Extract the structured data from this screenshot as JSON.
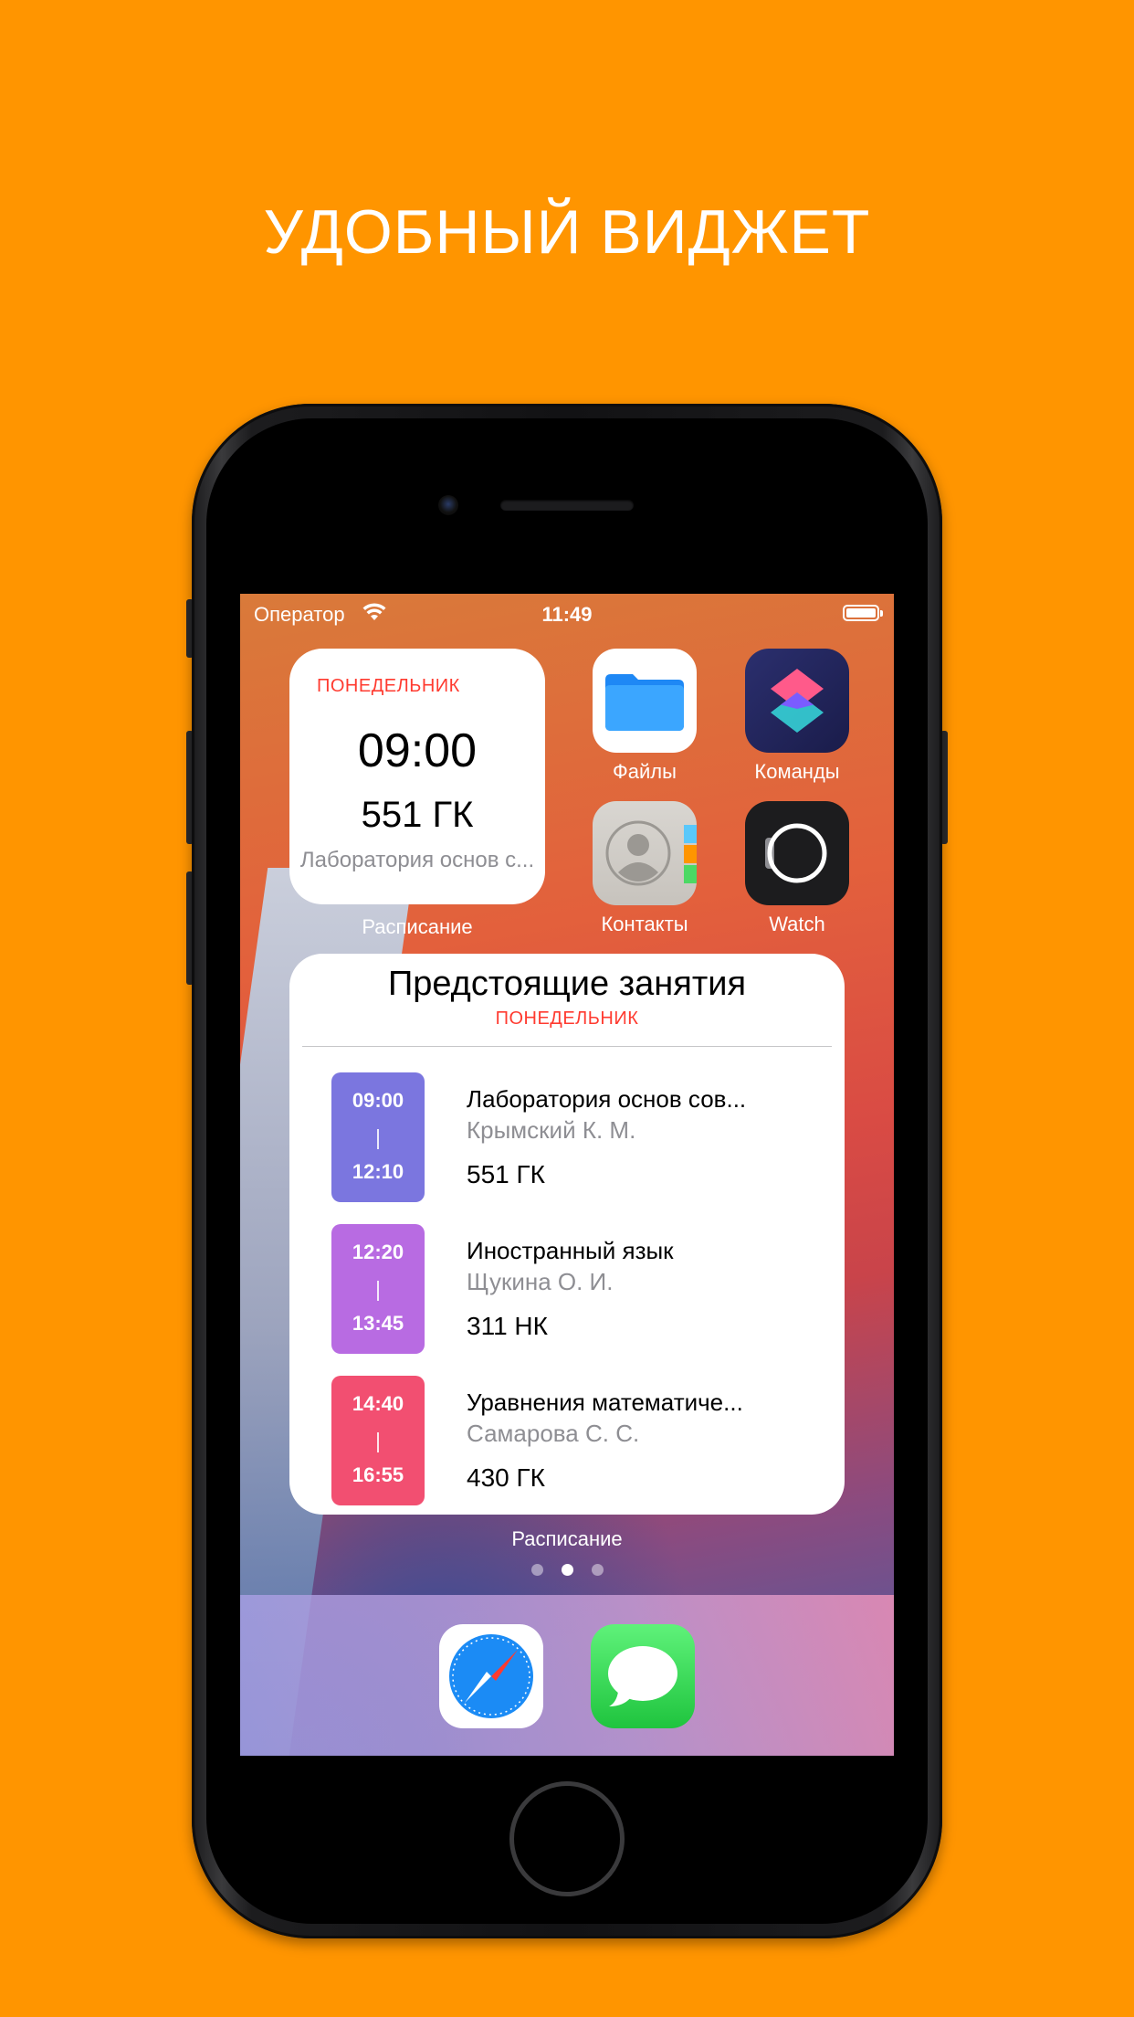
{
  "headline": "УДОБНЫЙ ВИДЖЕТ",
  "status_bar": {
    "carrier": "Оператор",
    "time": "11:49"
  },
  "small_widget": {
    "day": "ПОНЕДЕЛЬНИК",
    "time": "09:00",
    "room": "551 ГК",
    "subject": "Лаборатория основ с...",
    "label": "Расписание"
  },
  "apps": {
    "files": "Файлы",
    "shortcuts": "Команды",
    "contacts": "Контакты",
    "watch": "Watch"
  },
  "large_widget": {
    "title": "Предстоящие занятия",
    "day": "ПОНЕДЕЛЬНИК",
    "lessons": [
      {
        "start": "09:00",
        "end": "12:10",
        "subject": "Лаборатория основ сов...",
        "teacher": "Крымский К. М.",
        "room": "551 ГК",
        "color": "#7B76DF"
      },
      {
        "start": "12:20",
        "end": "13:45",
        "subject": "Иностранный язык",
        "teacher": "Щукина О. И.",
        "room": "311 НК",
        "color": "#B86BE2"
      },
      {
        "start": "14:40",
        "end": "16:55",
        "subject": "Уравнения математиче...",
        "teacher": "Самарова С. С.",
        "room": "430 ГК",
        "color": "#F24F71"
      }
    ],
    "caption": "Расписание"
  },
  "page_indicator": {
    "count": 3,
    "active": 2
  },
  "dock": {
    "apps": [
      "safari-icon",
      "messages-icon"
    ]
  },
  "colors": {
    "background": "#FF9500",
    "accent_red": "#FF3B30"
  }
}
